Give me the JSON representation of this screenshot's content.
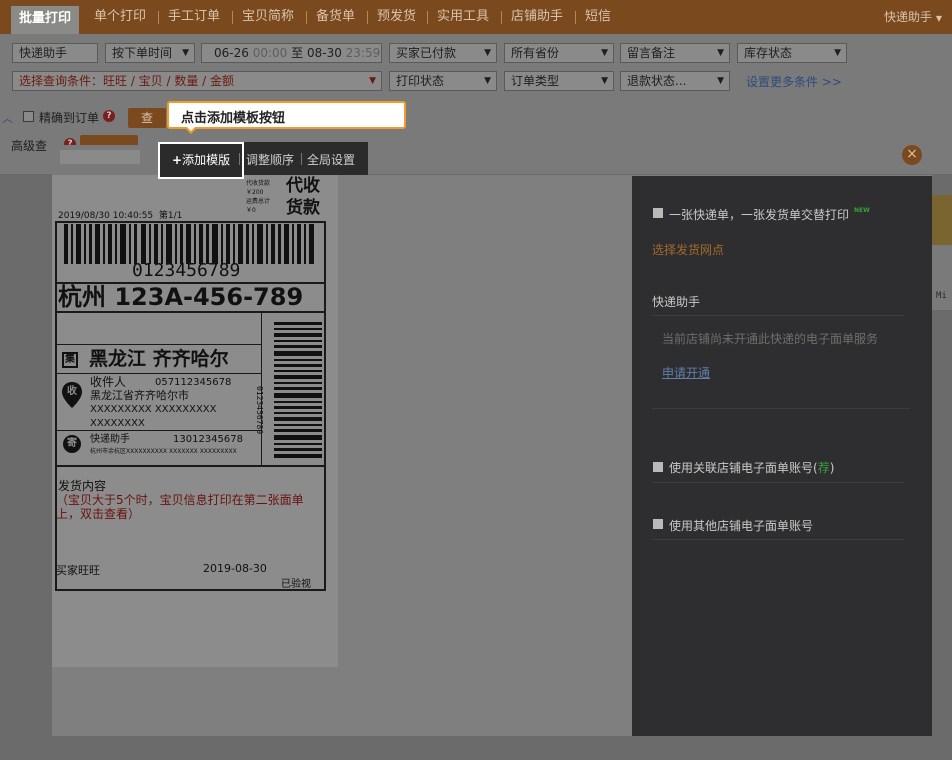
{
  "nav": {
    "tabs": [
      "批量打印",
      "单个打印",
      "手工订单",
      "宝贝简称",
      "备货单",
      "预发货",
      "实用工具",
      "店铺助手",
      "短信"
    ],
    "user": "快递助手",
    "user_arrow": "▼"
  },
  "filters": {
    "express": "快递助手",
    "time_type": "按下单时间",
    "date_from": "06-26",
    "time_from": "00:00",
    "to": "至",
    "date_to": "08-30",
    "time_to": "23:59",
    "pay_status": "买家已付款",
    "province": "所有省份",
    "remark": "留言备注",
    "stock": "库存状态",
    "query_cond": "选择查询条件：旺旺 / 宝贝 / 数量 / 金额",
    "print_status": "打印状态",
    "order_type": "订单类型",
    "refund_status": "退款状态...",
    "more_link": "设置更多条件 >>",
    "exact_match": "精确到订单",
    "query_btn": "查",
    "advanced": "高级查"
  },
  "toolbar": {
    "add_template": "添加模版",
    "adjust_order": "调整顺序",
    "global_settings": "全局设置",
    "plus": "+"
  },
  "tooltip": {
    "text": "点击添加模板按钮"
  },
  "waybill": {
    "cod_label1": "代收货款",
    "cod_value": "￥200",
    "fee_label": "运费总计",
    "fee_value": "￥0",
    "cod_big": [
      "代收",
      "货款"
    ],
    "datetime": "2019/08/30  10:40:55",
    "page": "第1/1",
    "barcode_num": "0123456789",
    "route": "杭州  123A-456-789",
    "dest_icon": "集",
    "dest": "黑龙江  齐齐哈尔",
    "recv_icon": "收",
    "recv_name": "收件人",
    "recv_phone": "057112345678",
    "recv_addr1": "黑龙江省齐齐哈尔市",
    "recv_addr2": "XXXXXXXXX  XXXXXXXXX",
    "recv_addr3": "XXXXXXXX",
    "send_icon": "寄",
    "send_name": "快递助手",
    "send_phone": "13012345678",
    "send_addr": "杭州市余杭区XXXXXXXXXX  XXXXXXX  XXXXXXXXX",
    "vertical_barcode_num": "0123456789",
    "content_label": "发货内容",
    "content_note": "（宝贝大于5个时，宝贝信息打印在第二张面单上，双击查看）",
    "buyer": "买家旺旺",
    "date": "2019-08-30",
    "checked": "已验视"
  },
  "right_panel": {
    "alt_print": "一张快递单，一张发货单交替打印",
    "new_badge": "NEW",
    "select_outlet": "选择发货网点",
    "section_title": "快递助手",
    "notice": "当前店铺尚未开通此快递的电子面单服务",
    "apply_link": "申请开通",
    "use_linked": "使用关联店铺电子面单账号(",
    "use_linked_rec": "荐",
    "use_linked_end": ")",
    "use_other": "使用其他店铺电子面单账号"
  },
  "side_strip": {
    "text": "Mi"
  },
  "close_icon": "×"
}
